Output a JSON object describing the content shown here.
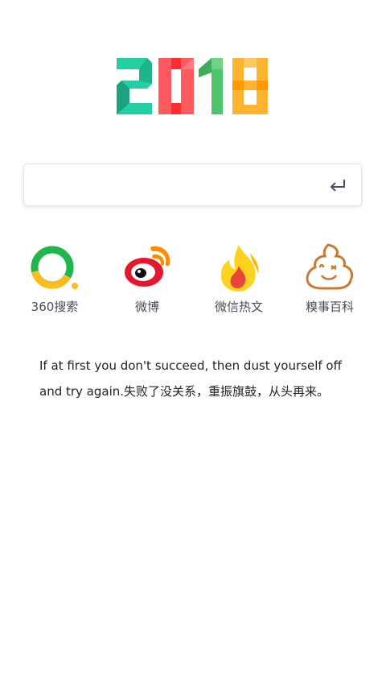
{
  "logo": {
    "year": "2018",
    "colors": [
      "#25cfa4",
      "#ff5a5f",
      "#4fc56b",
      "#ffb431"
    ]
  },
  "search": {
    "value": "",
    "placeholder": "",
    "submit_icon": "enter-return-icon"
  },
  "shortcuts": [
    {
      "label": "360搜索",
      "icon": "so360-logo-icon"
    },
    {
      "label": "微博",
      "icon": "weibo-logo-icon"
    },
    {
      "label": "微信热文",
      "icon": "flame-icon"
    },
    {
      "label": "糗事百科",
      "icon": "qiushibaike-poop-icon"
    }
  ],
  "quote": {
    "text": "If at first you don't succeed, then dust yourself off and try again.失败了没关系，重振旗鼓，从头再来。"
  }
}
